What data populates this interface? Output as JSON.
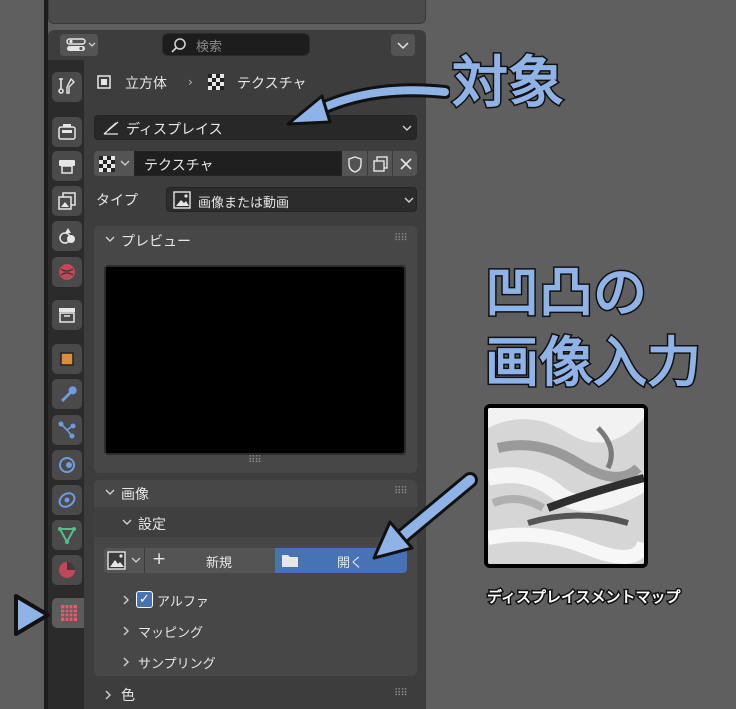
{
  "header": {
    "search_placeholder": "検索"
  },
  "breadcrumb": {
    "object": "立方体",
    "texture": "テクスチャ"
  },
  "target_selector": {
    "value": "ディスプレイス"
  },
  "texture_datablock": {
    "name": "テクスチャ"
  },
  "type_row": {
    "label": "タイプ",
    "value": "画像または動画"
  },
  "panels": {
    "preview": "プレビュー",
    "image": "画像",
    "settings": "設定",
    "color": "色"
  },
  "image_buttons": {
    "new_label": "新規",
    "open_label": "開く"
  },
  "subpanels": {
    "alpha": "アルファ",
    "mapping": "マッピング",
    "sampling": "サンプリング"
  },
  "annotations": {
    "target": "対象",
    "bump_line1": "凹凸の",
    "bump_line2": "画像入力",
    "map_caption": "ディスプレイスメントマップ"
  },
  "colors": {
    "accent_blue": "#4772b3",
    "annotation_blue": "#8fb3e6",
    "active_tab_pink": "#e05d6a"
  }
}
